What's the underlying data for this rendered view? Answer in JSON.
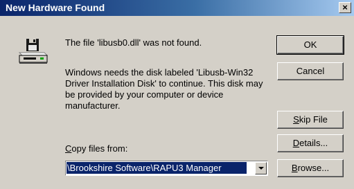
{
  "window": {
    "title": "New Hardware Found",
    "close_glyph": "×"
  },
  "message": {
    "not_found": "The file 'libusb0.dll' was not found.",
    "instructions": "Windows needs the disk labeled 'Libusb-Win32 Driver Installation Disk' to continue. This disk may be provided by your computer or device manufacturer."
  },
  "copy_from": {
    "label_mnemonic": "C",
    "label_rest": "opy files from:",
    "value": "\\Brookshire Software\\RAPU3 Manager"
  },
  "buttons": {
    "ok": "OK",
    "cancel": "Cancel",
    "skip_mnemonic": "S",
    "skip_rest": "kip File",
    "details_mnemonic": "D",
    "details_rest": "etails...",
    "browse_mnemonic": "B",
    "browse_rest": "rowse..."
  },
  "icons": {
    "main": "disk-drive-icon",
    "close": "close-icon",
    "dropdown": "chevron-down-icon"
  }
}
